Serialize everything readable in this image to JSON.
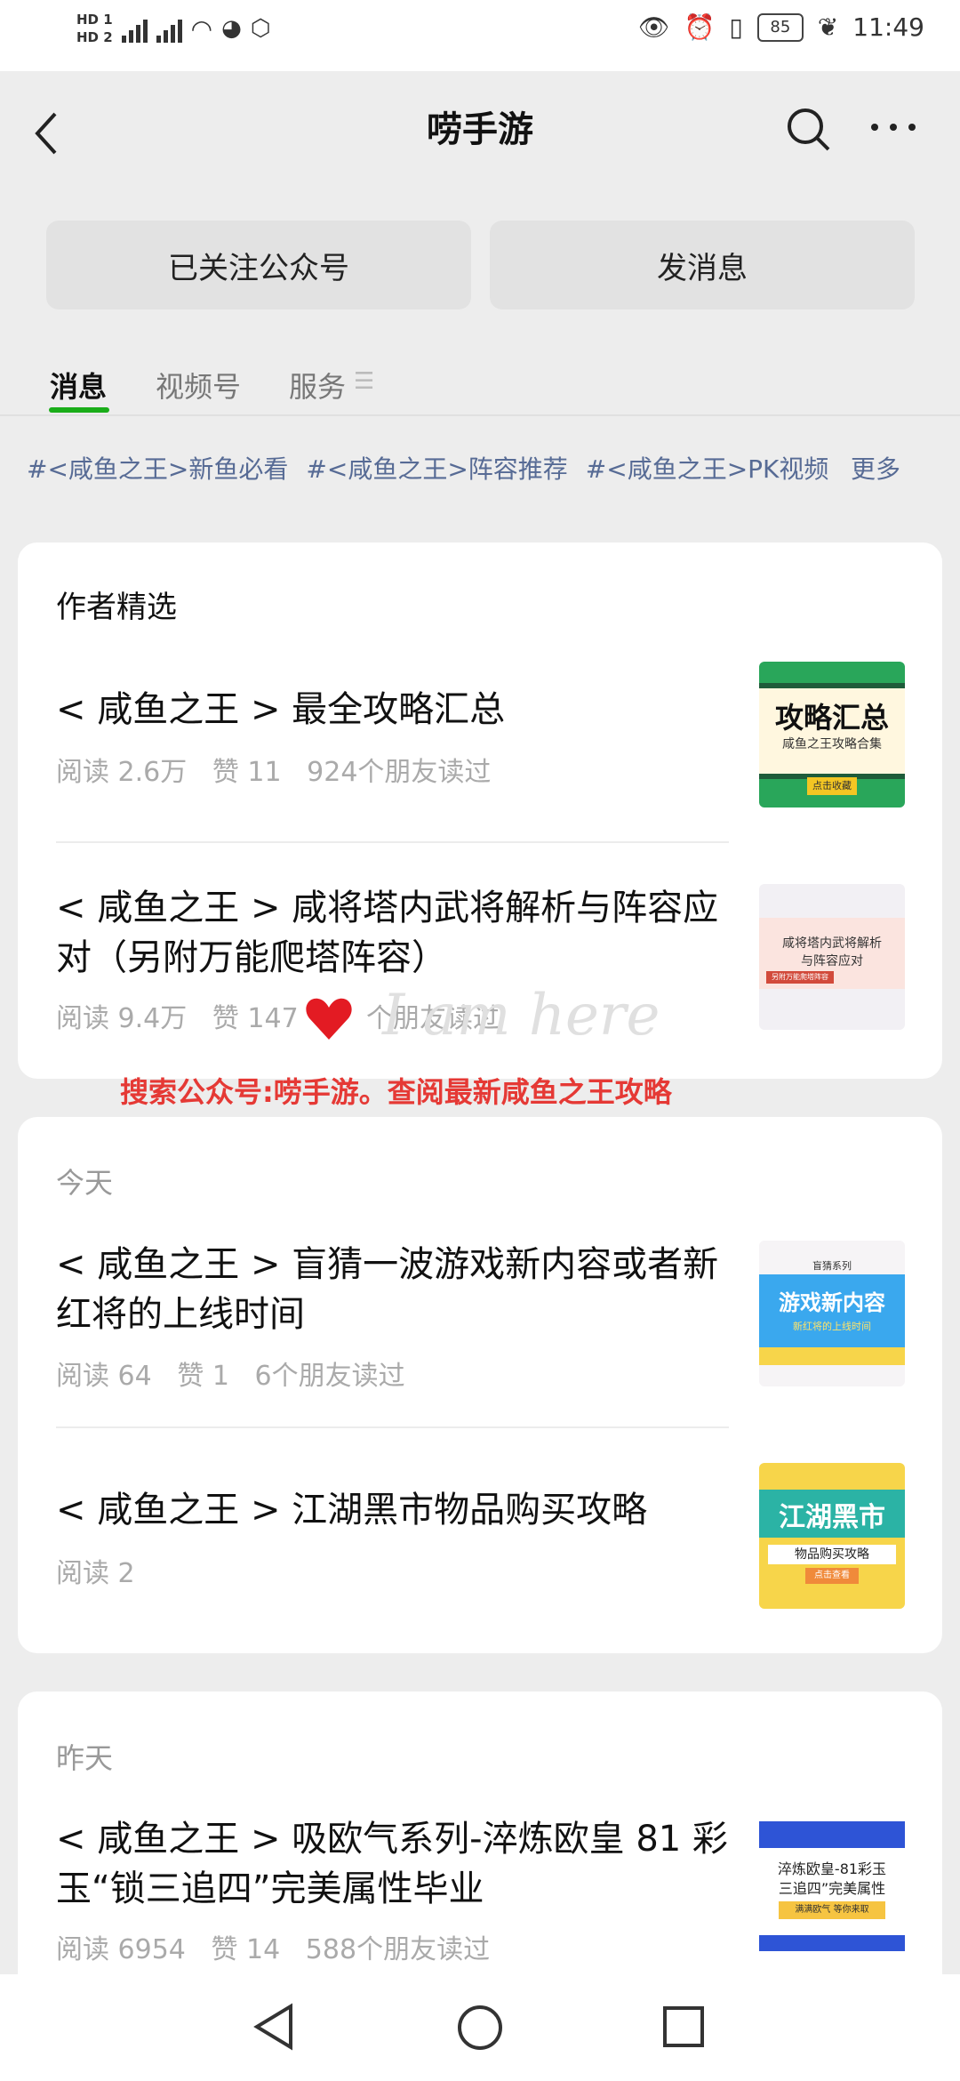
{
  "status_bar": {
    "time": "11:49",
    "battery": "85"
  },
  "header": {
    "title": "唠手游"
  },
  "buttons": {
    "followed": "已关注公众号",
    "message": "发消息"
  },
  "tabs": [
    {
      "label": "消息",
      "active": true
    },
    {
      "label": "视频号",
      "active": false
    },
    {
      "label": "服务",
      "active": false
    }
  ],
  "tags": [
    "#<咸鱼之王>新鱼必看",
    "#<咸鱼之王>阵容推荐",
    "#<咸鱼之王>PK视频"
  ],
  "tags_more": "更多",
  "featured": {
    "title": "作者精选",
    "articles": [
      {
        "title": "< 咸鱼之王 > 最全攻略汇总",
        "meta": "阅读 2.6万   赞 11   924个朋友读过",
        "thumb_text": "攻略汇总",
        "thumb_sub": "咸鱼之王攻略合集",
        "thumb_btn": "点击收藏"
      },
      {
        "title": "< 咸鱼之王 > 咸将塔内武将解析与阵容应对（另附万能爬塔阵容）",
        "meta": "阅读 9.4万   赞 147   3   个朋友读过",
        "thumb_text": "咸将塔内武将解析",
        "thumb_sub": "与阵容应对",
        "thumb_btn": "另附万能爬塔阵容"
      }
    ]
  },
  "overlay_text": "搜索公众号:唠手游。查阅最新咸鱼之王攻略",
  "watermark_text": "I am here",
  "today": {
    "date": "今天",
    "articles": [
      {
        "title": "< 咸鱼之王 > 盲猜一波游戏新内容或者新红将的上线时间",
        "meta": "阅读 64   赞 1   6个朋友读过",
        "thumb_text": "游戏新内容",
        "thumb_sub": "新红将的上线时间",
        "thumb_top": "盲猜系列"
      },
      {
        "title": "< 咸鱼之王 > 江湖黑市物品购买攻略",
        "meta": "阅读 2",
        "thumb_text": "江湖黑市",
        "thumb_sub": "物品购买攻略",
        "thumb_btn": "点击查看"
      }
    ]
  },
  "yesterday": {
    "date": "昨天",
    "articles": [
      {
        "title": "< 咸鱼之王 > 吸欧气系列-淬炼欧皇 81 彩玉“锁三追四”完美属性毕业",
        "meta": "阅读 6954   赞 14   588个朋友读过",
        "thumb_text": "淬炼欧皇-81彩玉",
        "thumb_sub": "三追四”完美属性",
        "thumb_btn": "满满欧气 等你来取"
      }
    ]
  }
}
